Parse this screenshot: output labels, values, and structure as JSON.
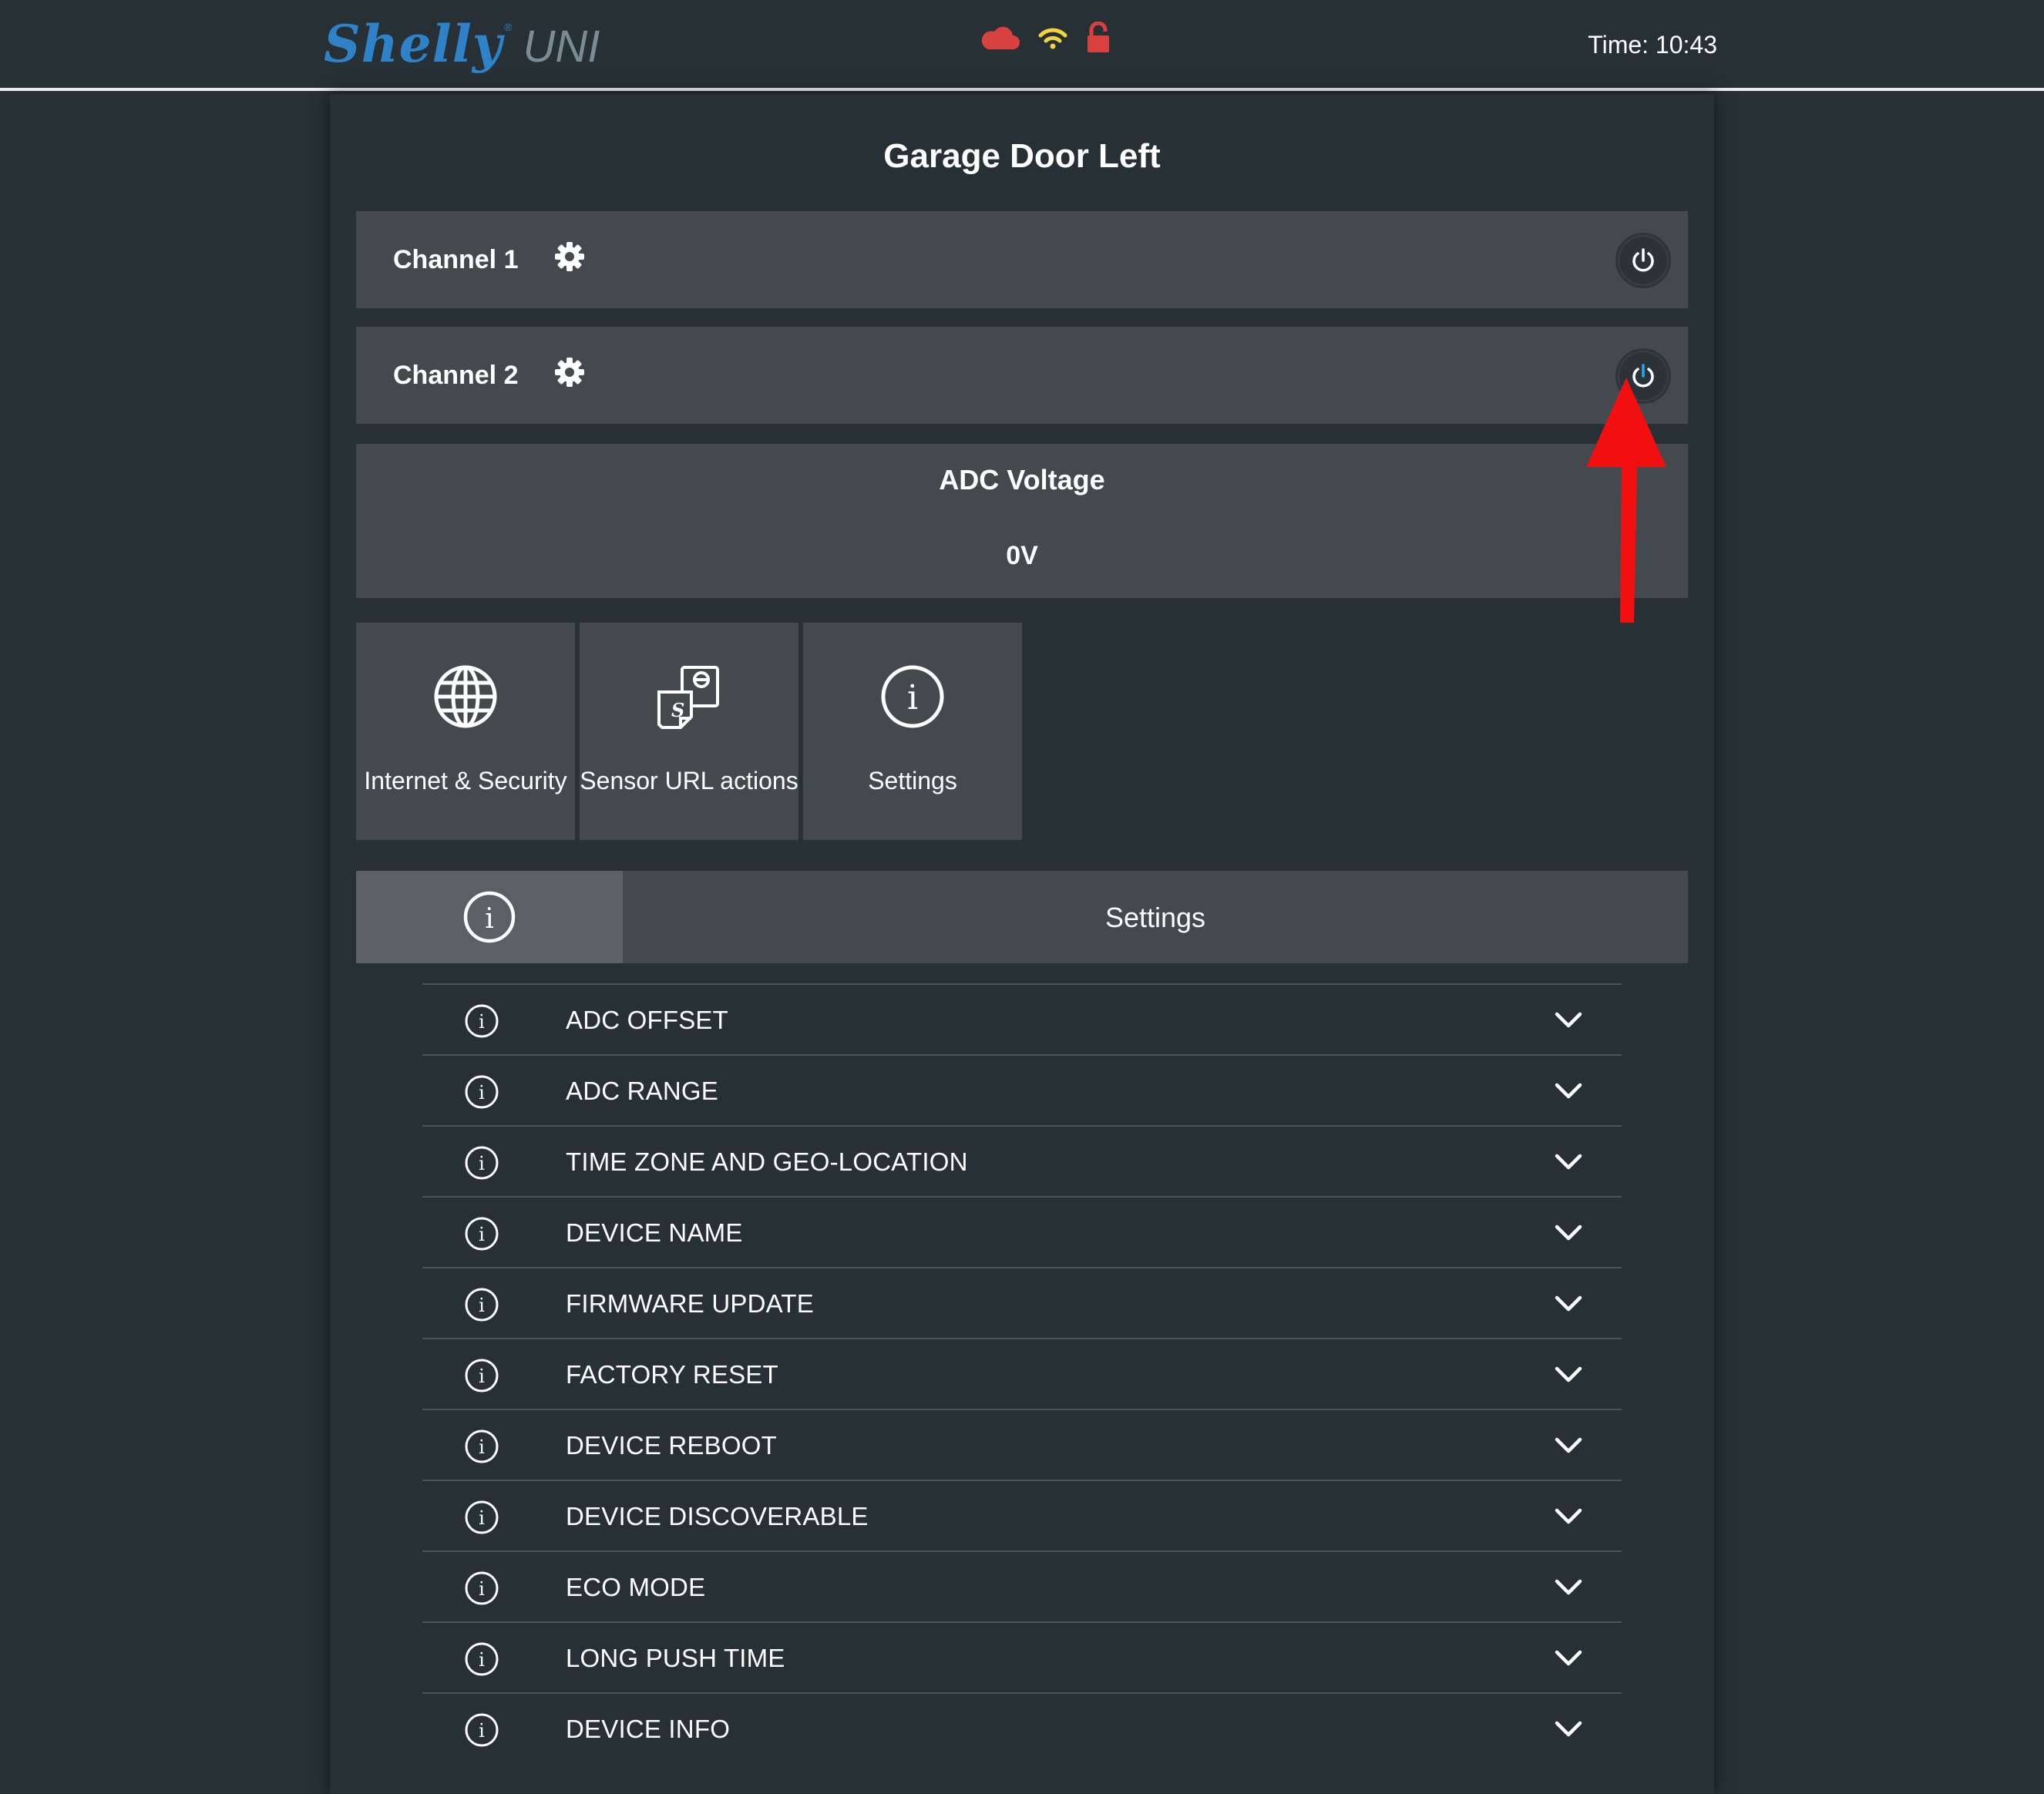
{
  "header": {
    "brand": "Shelly",
    "brand_mark": "®",
    "model": "UNI",
    "time_label": "Time: 10:43",
    "status_icons": [
      {
        "name": "cloud-icon",
        "color": "#d9413e"
      },
      {
        "name": "wifi-icon",
        "color": "#f2d43d"
      },
      {
        "name": "unlocked-icon",
        "color": "#d9413e"
      }
    ]
  },
  "page": {
    "title": "Garage Door Left"
  },
  "channels": [
    {
      "label": "Channel 1",
      "settings_icon": "gear-icon",
      "power_icon": "power-icon",
      "power_color": "#ffffff"
    },
    {
      "label": "Channel 2",
      "settings_icon": "gear-icon",
      "power_icon": "power-icon",
      "power_color": "#2aa3ef"
    }
  ],
  "adc": {
    "title": "ADC Voltage",
    "value": "0V"
  },
  "tiles": [
    {
      "label": "Internet & Security",
      "icon": "globe-icon"
    },
    {
      "label": "Sensor URL actions",
      "icon": "sensor-url-icon"
    },
    {
      "label": "Settings",
      "icon": "info-icon"
    }
  ],
  "settings": {
    "title": "Settings",
    "items": [
      "ADC OFFSET",
      "ADC RANGE",
      "TIME ZONE AND GEO-LOCATION",
      "DEVICE NAME",
      "FIRMWARE UPDATE",
      "FACTORY RESET",
      "DEVICE REBOOT",
      "DEVICE DISCOVERABLE",
      "ECO MODE",
      "LONG PUSH TIME",
      "DEVICE INFO"
    ]
  },
  "colors": {
    "background": "#263035",
    "card": "#43494d",
    "accent_blue": "#2d82c8",
    "annotation_arrow": "#f20f0f"
  },
  "annotation": {
    "icon": "red-arrow-icon",
    "points_to": "channel-2-power-button"
  }
}
